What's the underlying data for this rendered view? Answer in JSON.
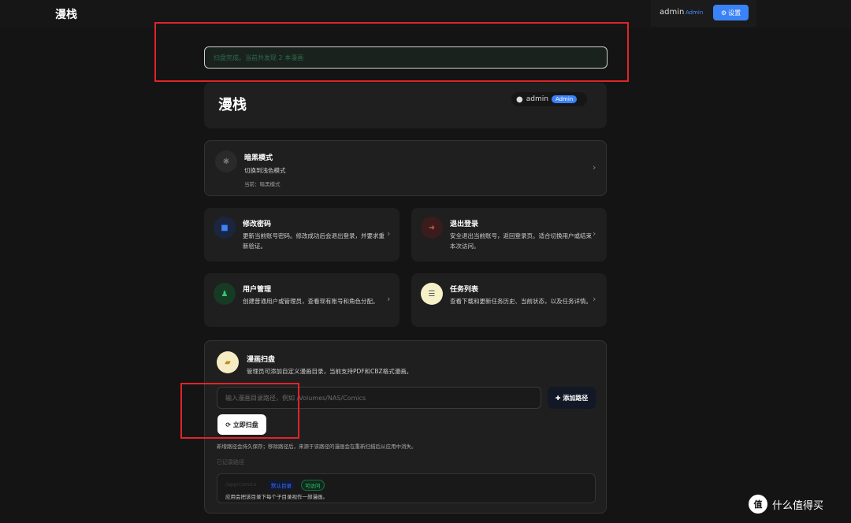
{
  "topbar": {
    "app_title": "漫栈",
    "user_name": "admin",
    "user_role": "Admin",
    "settings_icon": "gear-icon",
    "settings_label": "设置"
  },
  "toast": {
    "message": "扫盘完成。当前共发现 2 本漫画"
  },
  "header_card": {
    "title": "漫栈",
    "user_icon": "user-circle-icon",
    "user_name": "admin",
    "badge": "Admin"
  },
  "dark_mode": {
    "icon": "sun-icon",
    "title": "暗黑模式",
    "desc": "切换到浅色模式",
    "current": "当前：暗黑模式"
  },
  "change_password": {
    "icon": "lock-icon",
    "title": "修改密码",
    "desc": "更新当前账号密码。修改成功后会退出登录，并要求重新验证。"
  },
  "logout": {
    "icon": "logout-icon",
    "title": "退出登录",
    "desc": "安全退出当前账号，返回登录页。适合切换用户或结束本次访问。"
  },
  "user_management": {
    "icon": "users-icon",
    "title": "用户管理",
    "desc": "创建普通用户或管理员，查看现有账号和角色分配。"
  },
  "task_list": {
    "icon": "list-icon",
    "title": "任务列表",
    "desc": "查看下载和更新任务历史、当前状态，以及任务详情。"
  },
  "scan": {
    "icon": "folder-icon",
    "title": "漫画扫盘",
    "desc": "管理员可添加自定义漫画目录，当前支持PDF和CBZ格式漫画。",
    "input_placeholder": "输入漫画目录路径，例如 /Volumes/NAS/Comics",
    "add_button": "添加路径",
    "scan_button": "立即扫盘",
    "note": "新增路径会持久保存；移除路径后，来源于该路径的漫画会在重新扫描后从应用中消失。",
    "saved_label": "已记录路径",
    "saved_path": {
      "name": "/app/comics",
      "tag_default": "默认目录",
      "tag_status": "可访问",
      "desc": "应用会把该目录下每个子目录视作一部漫画。"
    }
  },
  "watermark": {
    "logo": "值",
    "text": "什么值得买"
  },
  "colors": {
    "accent": "#3b82f6",
    "highlight_box": "#e0242a",
    "background": "#141414",
    "card": "#1f1f1f"
  }
}
